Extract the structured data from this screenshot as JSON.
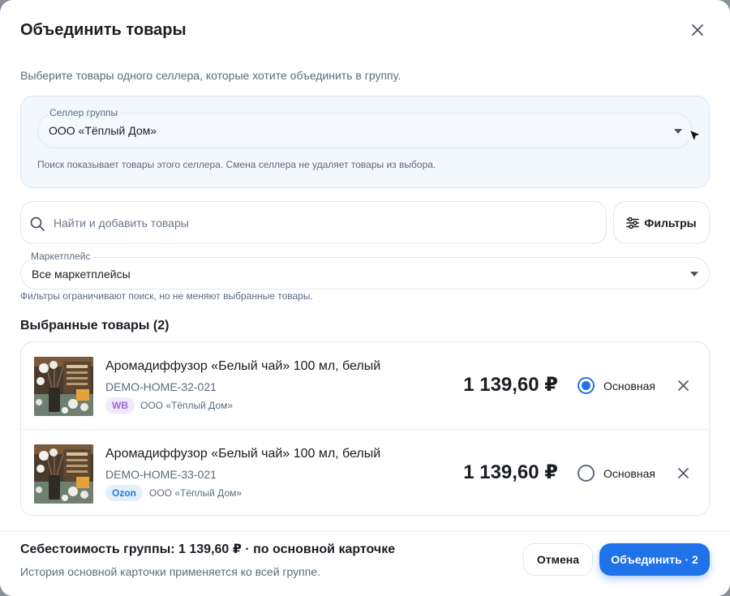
{
  "modal": {
    "title": "Объединить товары",
    "subtitle": "Выберите товары одного селлера, которые хотите объединить в группу."
  },
  "seller": {
    "label": "Селлер группы",
    "value": "ООО «Тёплый Дом»",
    "hint": "Поиск показывает товары этого селлера. Смена селлера не удаляет товары из выбора."
  },
  "search": {
    "placeholder": "Найти и добавить товары",
    "filters_label": "Фильтры"
  },
  "marketplace": {
    "label": "Маркетплейс",
    "value": "Все маркетплейсы",
    "hint": "Фильтры ограничивают поиск, но не меняют выбранные товары."
  },
  "selected": {
    "title": "Выбранные товары (2)",
    "items": [
      {
        "name": "Аромадиффузор «Белый чай» 100 мл, белый",
        "sku": "DEMO-HOME-32-021",
        "marketplace": "WB",
        "seller": "ООО «Тёплый Дом»",
        "price": "1 139,60 ₽",
        "primary_label": "Основная",
        "is_primary": true
      },
      {
        "name": "Аромадиффузор «Белый чай» 100 мл, белый",
        "sku": "DEMO-HOME-33-021",
        "marketplace": "Ozon",
        "seller": "ООО «Тёплый Дом»",
        "price": "1 139,60 ₽",
        "primary_label": "Основная",
        "is_primary": false
      }
    ]
  },
  "footer": {
    "cost_text": "Себестоимость группы: 1 139,60 ₽ · по основной карточке",
    "note": "История основной карточки применяется ко всей группе.",
    "cancel_label": "Отмена",
    "merge_label": "Объединить · 2"
  },
  "colors": {
    "accent": "#1f72e8",
    "wb_badge": "#9b6bd6",
    "ozon_badge": "#2a77c9"
  },
  "icons": [
    "close-icon",
    "chevron-down-icon",
    "search-icon",
    "sliders-icon",
    "remove-icon",
    "cursor-icon"
  ]
}
